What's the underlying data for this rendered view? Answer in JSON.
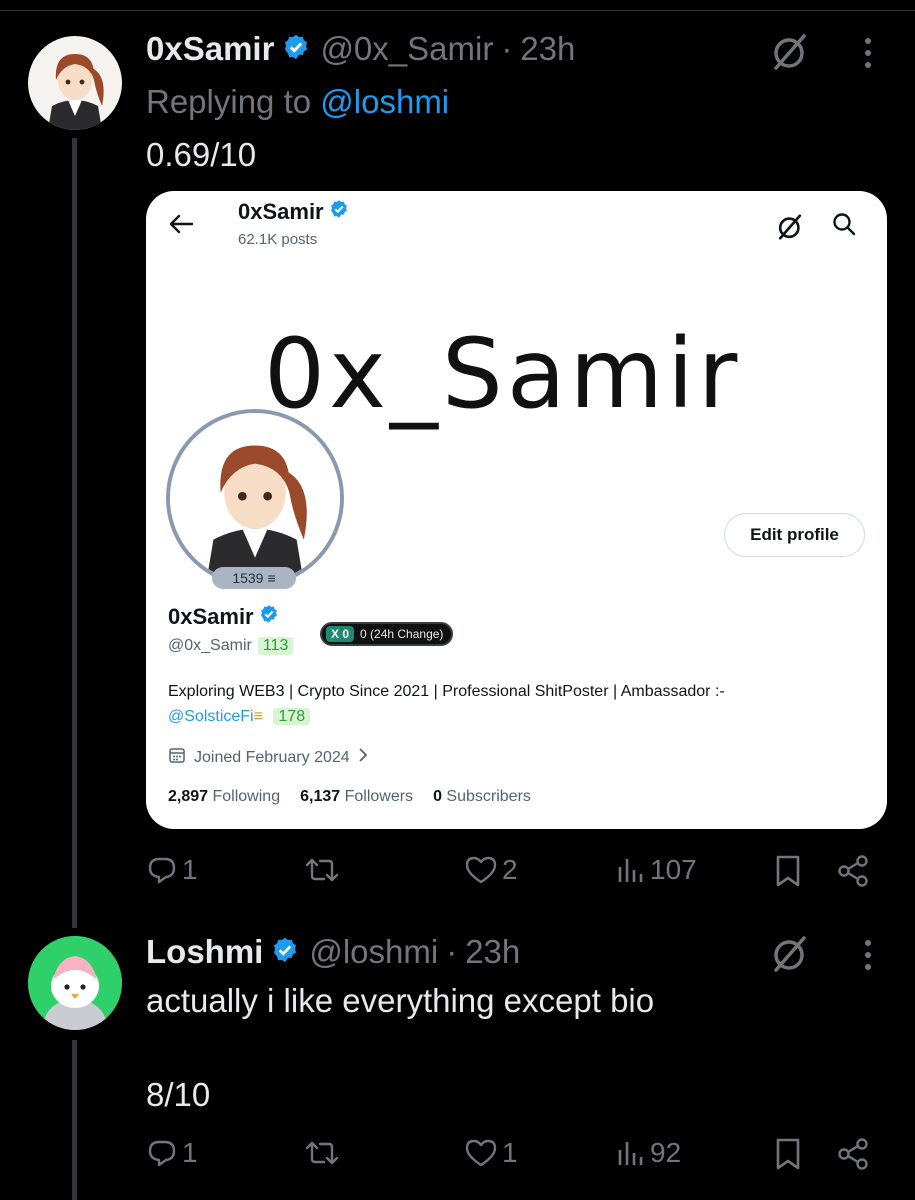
{
  "tweet1": {
    "display_name": "0xSamir",
    "handle": "@0x_Samir",
    "time": "23h",
    "replying_prefix": "Replying to",
    "replying_handle": "@loshmi",
    "text": "0.69/10",
    "card": {
      "name": "0xSamir",
      "posts": "62.1K posts",
      "banner_text": "0x_Samir",
      "avatar_badge": "1539",
      "edit_profile": "Edit profile",
      "display_name": "0xSamir",
      "handle": "@0x_Samir",
      "handle_score": "113",
      "change_x": "X 0",
      "change_text": "0 (24h Change)",
      "bio_text": "Exploring WEB3 | Crypto Since 2021 | Professional ShitPoster  | Ambassador :-",
      "bio_link": "@SolsticeFi",
      "bio_score": "178",
      "joined": "Joined February 2024",
      "following_count": "2,897",
      "following_label": "Following",
      "followers_count": "6,137",
      "followers_label": "Followers",
      "subscribers_count": "0",
      "subscribers_label": "Subscribers"
    },
    "actions": {
      "replies": "1",
      "likes": "2",
      "views": "107"
    }
  },
  "tweet2": {
    "display_name": "Loshmi",
    "handle": "@loshmi",
    "time": "23h",
    "text_line1": "actually i like everything except bio",
    "text_line2": "8/10",
    "actions": {
      "replies": "1",
      "likes": "1",
      "views": "92"
    }
  },
  "colors": {
    "accent": "#1d9bf0",
    "muted": "#71767b",
    "background": "#000000"
  },
  "icons": [
    "grok-icon",
    "more-icon",
    "verified-icon",
    "reply-icon",
    "repost-icon",
    "like-icon",
    "views-icon",
    "bookmark-icon",
    "share-icon",
    "back-arrow-icon",
    "search-icon",
    "calendar-icon"
  ]
}
